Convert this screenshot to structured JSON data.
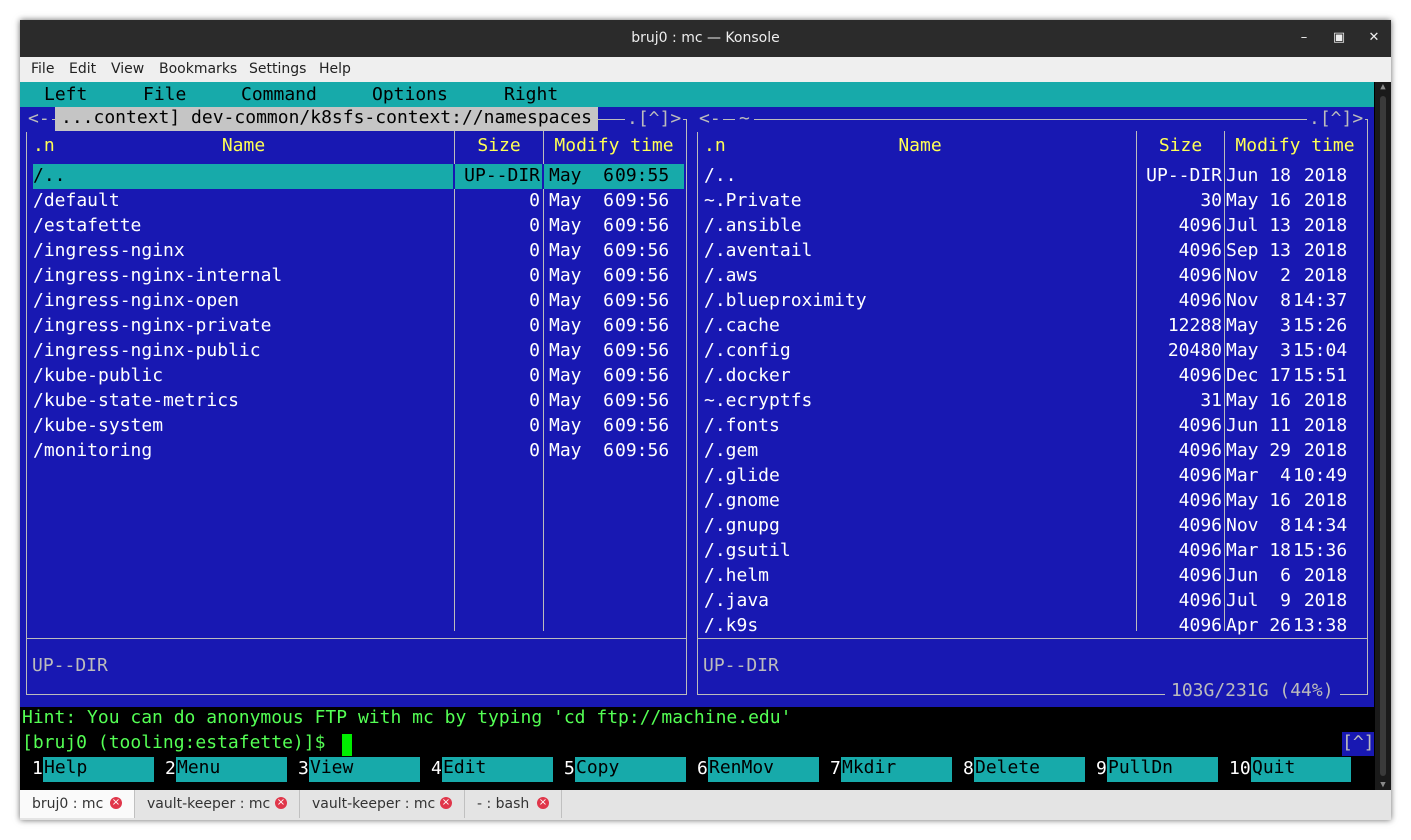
{
  "window": {
    "title": "bruj0 : mc — Konsole"
  },
  "konsole_menu": [
    "File",
    "Edit",
    "View",
    "Bookmarks",
    "Settings",
    "Help"
  ],
  "mc_menu": [
    "Left",
    "File",
    "Command",
    "Options",
    "Right"
  ],
  "left_panel": {
    "path": "...context] dev-common/k8sfs-context://namespaces",
    "nav_left": "<-",
    "nav_right": ".[^]>",
    "columns": {
      "n": ".n",
      "name": "Name",
      "size": "Size",
      "modify": "Modify time"
    },
    "rows": [
      {
        "name": "/..",
        "size": "UP--DIR",
        "date": "May  6",
        "time": "09:55",
        "selected": true
      },
      {
        "name": "/default",
        "size": "0",
        "date": "May  6",
        "time": "09:56"
      },
      {
        "name": "/estafette",
        "size": "0",
        "date": "May  6",
        "time": "09:56"
      },
      {
        "name": "/ingress-nginx",
        "size": "0",
        "date": "May  6",
        "time": "09:56"
      },
      {
        "name": "/ingress-nginx-internal",
        "size": "0",
        "date": "May  6",
        "time": "09:56"
      },
      {
        "name": "/ingress-nginx-open",
        "size": "0",
        "date": "May  6",
        "time": "09:56"
      },
      {
        "name": "/ingress-nginx-private",
        "size": "0",
        "date": "May  6",
        "time": "09:56"
      },
      {
        "name": "/ingress-nginx-public",
        "size": "0",
        "date": "May  6",
        "time": "09:56"
      },
      {
        "name": "/kube-public",
        "size": "0",
        "date": "May  6",
        "time": "09:56"
      },
      {
        "name": "/kube-state-metrics",
        "size": "0",
        "date": "May  6",
        "time": "09:56"
      },
      {
        "name": "/kube-system",
        "size": "0",
        "date": "May  6",
        "time": "09:56"
      },
      {
        "name": "/monitoring",
        "size": "0",
        "date": "May  6",
        "time": "09:56"
      }
    ],
    "status": "UP--DIR"
  },
  "right_panel": {
    "path": "~",
    "nav_left": "<-",
    "nav_right": ".[^]>",
    "columns": {
      "n": ".n",
      "name": "Name",
      "size": "Size",
      "modify": "Modify time"
    },
    "rows": [
      {
        "name": "/..",
        "size": "UP--DIR",
        "date": "Jun 18",
        "time": " 2018"
      },
      {
        "name": "~.Private",
        "size": "30",
        "date": "May 16",
        "time": " 2018"
      },
      {
        "name": "/.ansible",
        "size": "4096",
        "date": "Jul 13",
        "time": " 2018"
      },
      {
        "name": "/.aventail",
        "size": "4096",
        "date": "Sep 13",
        "time": " 2018"
      },
      {
        "name": "/.aws",
        "size": "4096",
        "date": "Nov  2",
        "time": " 2018"
      },
      {
        "name": "/.blueproximity",
        "size": "4096",
        "date": "Nov  8",
        "time": "14:37"
      },
      {
        "name": "/.cache",
        "size": "12288",
        "date": "May  3",
        "time": "15:26"
      },
      {
        "name": "/.config",
        "size": "20480",
        "date": "May  3",
        "time": "15:04"
      },
      {
        "name": "/.docker",
        "size": "4096",
        "date": "Dec 17",
        "time": "15:51"
      },
      {
        "name": "~.ecryptfs",
        "size": "31",
        "date": "May 16",
        "time": " 2018"
      },
      {
        "name": "/.fonts",
        "size": "4096",
        "date": "Jun 11",
        "time": " 2018"
      },
      {
        "name": "/.gem",
        "size": "4096",
        "date": "May 29",
        "time": " 2018"
      },
      {
        "name": "/.glide",
        "size": "4096",
        "date": "Mar  4",
        "time": "10:49"
      },
      {
        "name": "/.gnome",
        "size": "4096",
        "date": "May 16",
        "time": " 2018"
      },
      {
        "name": "/.gnupg",
        "size": "4096",
        "date": "Nov  8",
        "time": "14:34"
      },
      {
        "name": "/.gsutil",
        "size": "4096",
        "date": "Mar 18",
        "time": "15:36"
      },
      {
        "name": "/.helm",
        "size": "4096",
        "date": "Jun  6",
        "time": " 2018"
      },
      {
        "name": "/.java",
        "size": "4096",
        "date": "Jul  9",
        "time": " 2018"
      },
      {
        "name": "/.k9s",
        "size": "4096",
        "date": "Apr 26",
        "time": "13:38"
      }
    ],
    "status": "UP--DIR",
    "disk": "103G/231G (44%)"
  },
  "hint": "Hint: You can do anonymous FTP with mc by typing 'cd ftp://machine.edu'",
  "prompt": "[bruj0 (tooling:estafette)]$",
  "caret_label": "[^]",
  "fkeys": [
    {
      "num": "1",
      "label": "Help"
    },
    {
      "num": "2",
      "label": "Menu"
    },
    {
      "num": "3",
      "label": "View"
    },
    {
      "num": "4",
      "label": "Edit"
    },
    {
      "num": "5",
      "label": "Copy"
    },
    {
      "num": "6",
      "label": "RenMov"
    },
    {
      "num": "7",
      "label": "Mkdir"
    },
    {
      "num": "8",
      "label": "Delete"
    },
    {
      "num": "9",
      "label": "PullDn"
    },
    {
      "num": "10",
      "label": "Quit"
    }
  ],
  "tabs": [
    {
      "label": "bruj0 : mc",
      "active": true
    },
    {
      "label": "vault-keeper : mc",
      "active": false
    },
    {
      "label": "vault-keeper : mc",
      "active": false
    },
    {
      "label": "- : bash",
      "active": false
    }
  ],
  "colors": {
    "panel_bg": "#1818b2",
    "highlight": "#17aaaa",
    "header_yellow": "#ffff54",
    "hint_green": "#54ff54"
  }
}
